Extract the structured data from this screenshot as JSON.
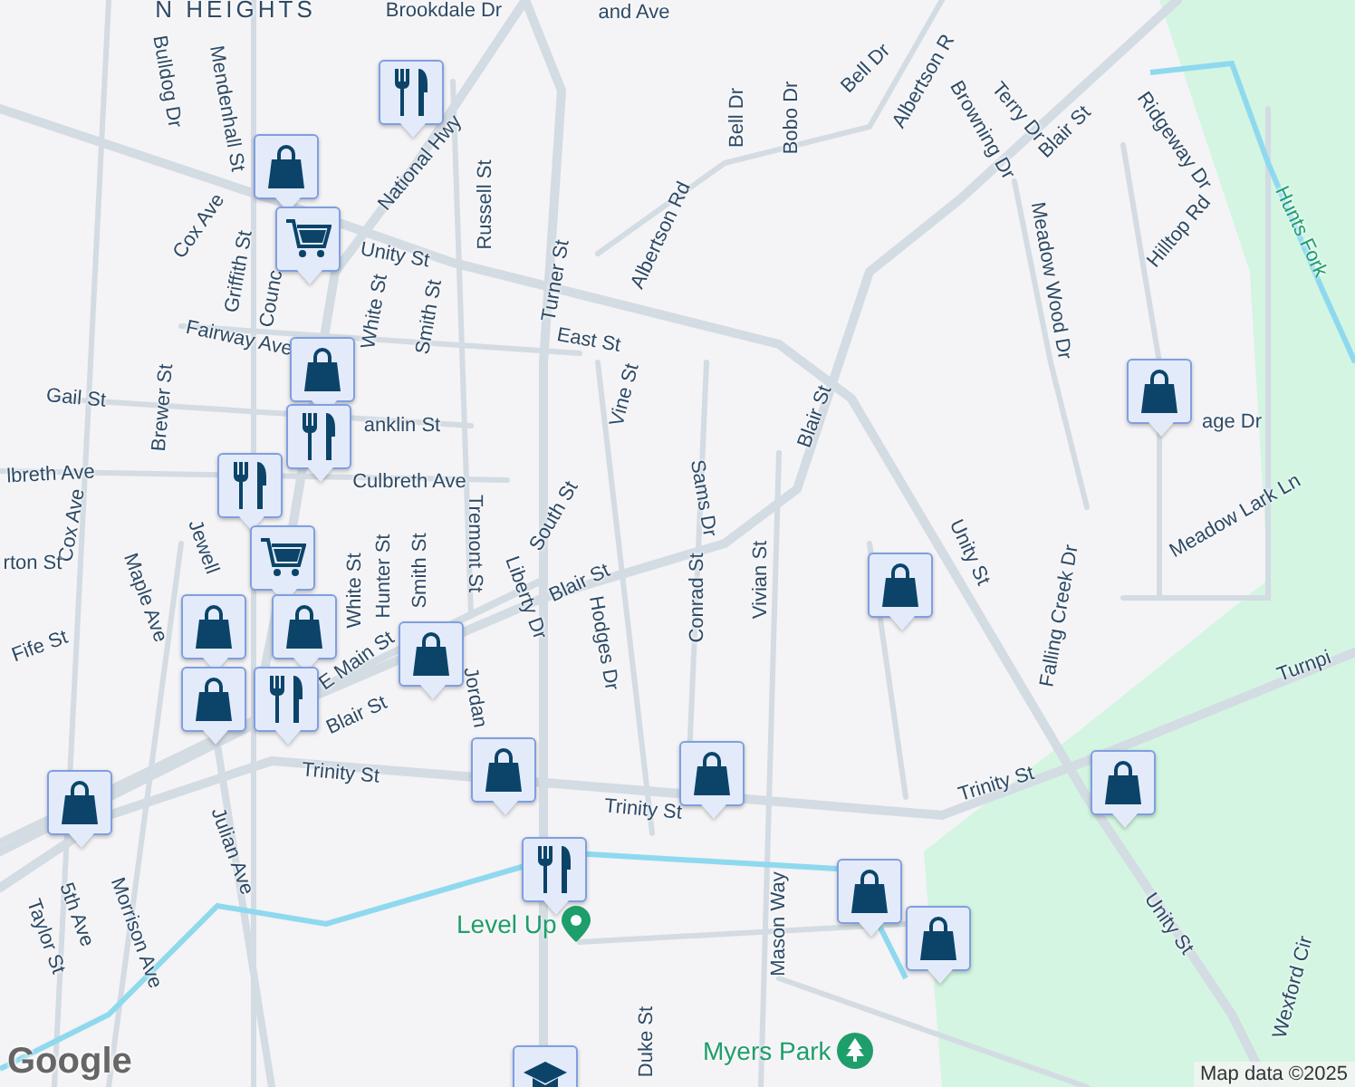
{
  "map": {
    "street_labels": [
      {
        "text": "N HEIGHTS",
        "kind": "area"
      },
      {
        "text": "Brookdale Dr",
        "kind": "street"
      },
      {
        "text": "and Ave",
        "kind": "street"
      },
      {
        "text": "Bulldog Dr",
        "kind": "street"
      },
      {
        "text": "Mendenhall St",
        "kind": "street"
      },
      {
        "text": "National Hwy",
        "kind": "street"
      },
      {
        "text": "Russell St",
        "kind": "street"
      },
      {
        "text": "Cox Ave",
        "kind": "street"
      },
      {
        "text": "Griffith St",
        "kind": "street"
      },
      {
        "text": "Unity St",
        "kind": "street"
      },
      {
        "text": "Counc",
        "kind": "street"
      },
      {
        "text": "White St",
        "kind": "street"
      },
      {
        "text": "Smith St",
        "kind": "street"
      },
      {
        "text": "Turner St",
        "kind": "street"
      },
      {
        "text": "Albertson Rd",
        "kind": "street"
      },
      {
        "text": "Fairway Ave",
        "kind": "street"
      },
      {
        "text": "East St",
        "kind": "street"
      },
      {
        "text": "Vine St",
        "kind": "street"
      },
      {
        "text": "Gail St",
        "kind": "street"
      },
      {
        "text": "Brewer St",
        "kind": "street"
      },
      {
        "text": "anklin St",
        "kind": "street"
      },
      {
        "text": "Culbreth Ave",
        "kind": "street"
      },
      {
        "text": "lbreth Ave",
        "kind": "street"
      },
      {
        "text": "Tremont St",
        "kind": "street"
      },
      {
        "text": "South St",
        "kind": "street"
      },
      {
        "text": "Cox Ave",
        "kind": "street"
      },
      {
        "text": "rton St",
        "kind": "street"
      },
      {
        "text": "Maple Ave",
        "kind": "street"
      },
      {
        "text": "Jewell",
        "kind": "street"
      },
      {
        "text": "Hunter St",
        "kind": "street"
      },
      {
        "text": "Smith St",
        "kind": "street"
      },
      {
        "text": "White St",
        "kind": "street"
      },
      {
        "text": "Fife St",
        "kind": "street"
      },
      {
        "text": "E Main St",
        "kind": "street"
      },
      {
        "text": "Blair St",
        "kind": "street"
      },
      {
        "text": "Blair St",
        "kind": "street"
      },
      {
        "text": "Liberty Dr",
        "kind": "street"
      },
      {
        "text": "Hodges Dr",
        "kind": "street"
      },
      {
        "text": "Jordan",
        "kind": "street"
      },
      {
        "text": "Trinity St",
        "kind": "street"
      },
      {
        "text": "Trinity St",
        "kind": "street"
      },
      {
        "text": "Trinity St",
        "kind": "street"
      },
      {
        "text": "Julian Ave",
        "kind": "street"
      },
      {
        "text": "Morrison Ave",
        "kind": "street"
      },
      {
        "text": "5th Ave",
        "kind": "street"
      },
      {
        "text": "Taylor St",
        "kind": "street"
      },
      {
        "text": "Duke St",
        "kind": "street"
      },
      {
        "text": "Sams Dr",
        "kind": "street"
      },
      {
        "text": "Conrad St",
        "kind": "street"
      },
      {
        "text": "Vivian St",
        "kind": "street"
      },
      {
        "text": "Bell Dr",
        "kind": "street"
      },
      {
        "text": "Bell Dr",
        "kind": "street"
      },
      {
        "text": "Bobo Dr",
        "kind": "street"
      },
      {
        "text": "Albertson R",
        "kind": "street"
      },
      {
        "text": "Browning Dr",
        "kind": "street"
      },
      {
        "text": "Terry Dr",
        "kind": "street"
      },
      {
        "text": "Blair St",
        "kind": "street"
      },
      {
        "text": "Ridgeway Dr",
        "kind": "street"
      },
      {
        "text": "Hilltop Rd",
        "kind": "street"
      },
      {
        "text": "Hunts Fork",
        "kind": "water"
      },
      {
        "text": "Meadow Wood Dr",
        "kind": "street"
      },
      {
        "text": "Blair St",
        "kind": "street"
      },
      {
        "text": "age Dr",
        "kind": "street"
      },
      {
        "text": "Unity St",
        "kind": "street"
      },
      {
        "text": "Falling Creek Dr",
        "kind": "street"
      },
      {
        "text": "Meadow Lark Ln",
        "kind": "street"
      },
      {
        "text": "Turnpi",
        "kind": "street"
      },
      {
        "text": "Unity St",
        "kind": "street"
      },
      {
        "text": "Mason Way",
        "kind": "street"
      },
      {
        "text": "Wexford Cir",
        "kind": "street"
      }
    ],
    "places": [
      {
        "name": "Level Up",
        "kind": "venue"
      },
      {
        "name": "Myers Park",
        "kind": "park"
      }
    ],
    "markers": [
      {
        "kind": "restaurant"
      },
      {
        "kind": "shopping"
      },
      {
        "kind": "cart"
      },
      {
        "kind": "shopping"
      },
      {
        "kind": "restaurant"
      },
      {
        "kind": "restaurant"
      },
      {
        "kind": "cart"
      },
      {
        "kind": "shopping"
      },
      {
        "kind": "shopping"
      },
      {
        "kind": "shopping"
      },
      {
        "kind": "restaurant"
      },
      {
        "kind": "shopping"
      },
      {
        "kind": "shopping"
      },
      {
        "kind": "shopping"
      },
      {
        "kind": "restaurant"
      },
      {
        "kind": "school"
      },
      {
        "kind": "shopping"
      },
      {
        "kind": "shopping"
      },
      {
        "kind": "shopping"
      },
      {
        "kind": "shopping"
      },
      {
        "kind": "shopping"
      },
      {
        "kind": "shopping"
      }
    ],
    "logo": "Google",
    "attribution": "Map data ©2025"
  }
}
